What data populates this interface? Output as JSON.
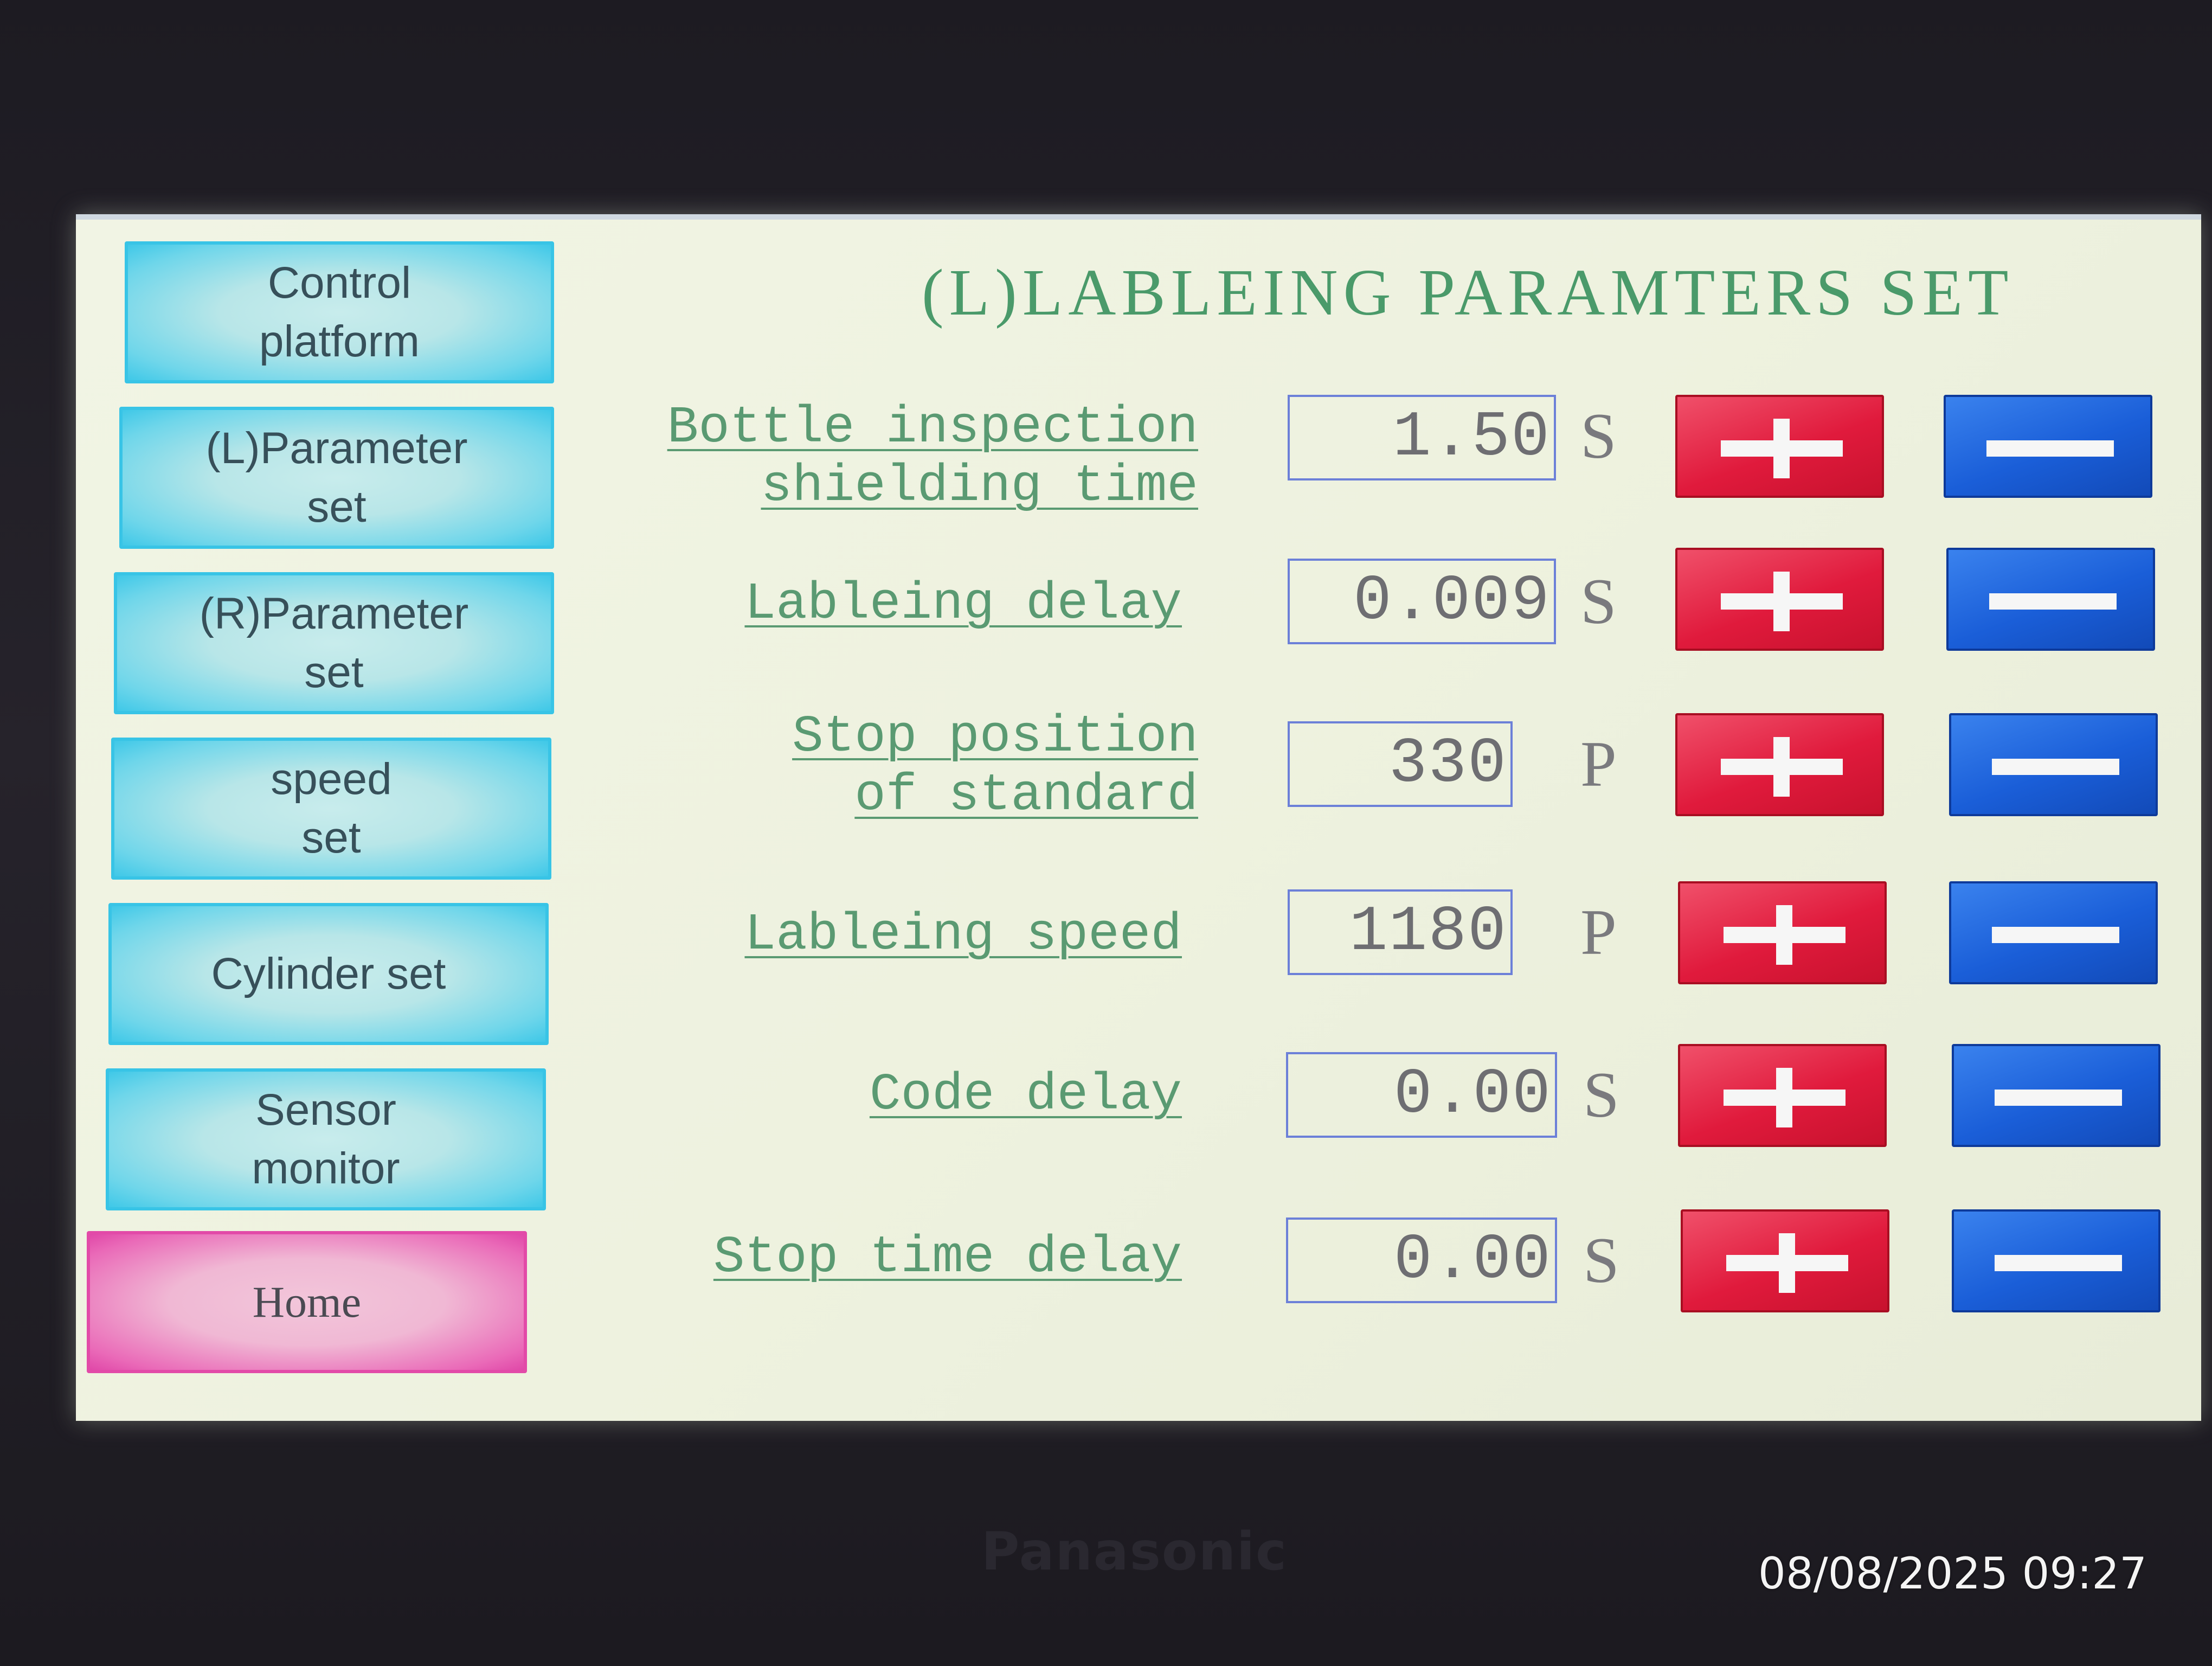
{
  "device": {
    "brand": "Panasonic",
    "timestamp": "08/08/2025 09:27"
  },
  "title": "(L)LABLEING PARAMTERS SET",
  "nav": {
    "control_platform": "Control\nplatform",
    "l_parameter_set": "(L)Parameter\nset",
    "r_parameter_set": "(R)Parameter\nset",
    "speed_set": "speed\nset",
    "cylinder_set": "Cylinder set",
    "sensor_monitor": "Sensor\nmonitor",
    "home": "Home"
  },
  "params": [
    {
      "label": "Bottle inspection\nshielding time",
      "value": "1.50",
      "unit": "S"
    },
    {
      "label": "Lableing delay",
      "value": "0.009",
      "unit": "S"
    },
    {
      "label": "Stop position\nof standard",
      "value": "330",
      "unit": "P"
    },
    {
      "label": "Lableing speed",
      "value": "1180",
      "unit": "P"
    },
    {
      "label": "Code delay",
      "value": "0.00",
      "unit": "S"
    },
    {
      "label": "Stop time delay",
      "value": "0.00",
      "unit": "S"
    }
  ],
  "colors": {
    "accent_cyan": "#3fc8e8",
    "home_pink": "#e048a8",
    "plus_red": "#e01a3c",
    "minus_blue": "#1a5ed8",
    "label_green": "#5a9a72"
  }
}
